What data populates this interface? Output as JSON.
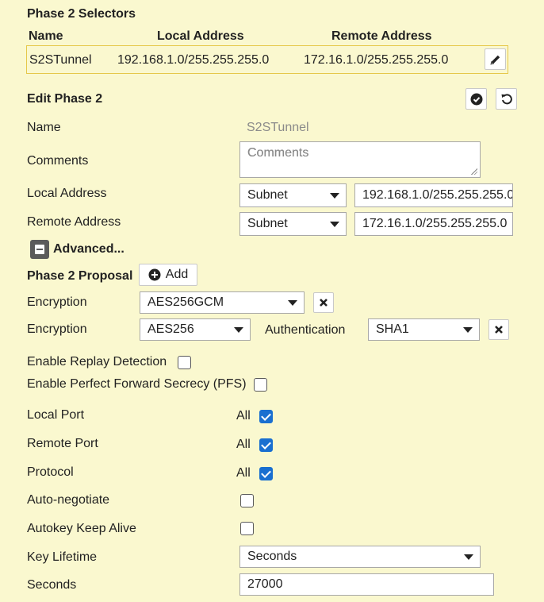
{
  "selectors": {
    "title": "Phase 2 Selectors",
    "columns": [
      "Name",
      "Local Address",
      "Remote Address"
    ],
    "row": {
      "name": "S2STunnel",
      "local": "192.168.1.0/255.255.255.0",
      "remote": "172.16.1.0/255.255.255.0"
    }
  },
  "edit": {
    "title": "Edit Phase 2",
    "name_label": "Name",
    "name_value": "S2STunnel",
    "comments_label": "Comments",
    "comments_placeholder": "Comments",
    "local_label": "Local Address",
    "local_type": "Subnet",
    "local_value": "192.168.1.0/255.255.255.0",
    "remote_label": "Remote Address",
    "remote_type": "Subnet",
    "remote_value": "172.16.1.0/255.255.255.0",
    "advanced_label": "Advanced...",
    "proposal_label": "Phase 2 Proposal",
    "add_label": "Add",
    "encryption_label": "Encryption",
    "encryption1": "AES256GCM",
    "encryption2": "AES256",
    "authentication_label": "Authentication",
    "authentication": "SHA1",
    "replay_label": "Enable Replay Detection",
    "replay_checked": false,
    "pfs_label": "Enable Perfect Forward Secrecy (PFS)",
    "pfs_checked": false,
    "local_port_label": "Local Port",
    "local_port_all": "All",
    "local_port_checked": true,
    "remote_port_label": "Remote Port",
    "remote_port_all": "All",
    "remote_port_checked": true,
    "protocol_label": "Protocol",
    "protocol_all": "All",
    "protocol_checked": true,
    "autoneg_label": "Auto-negotiate",
    "autoneg_checked": false,
    "keepalive_label": "Autokey Keep Alive",
    "keepalive_checked": false,
    "lifetime_label": "Key Lifetime",
    "lifetime_value": "Seconds",
    "seconds_label": "Seconds",
    "seconds_value": "27000"
  },
  "colors": {
    "background": "#faf8cf",
    "accent": "#1a6fd0",
    "selected_border": "#e6c84a"
  }
}
